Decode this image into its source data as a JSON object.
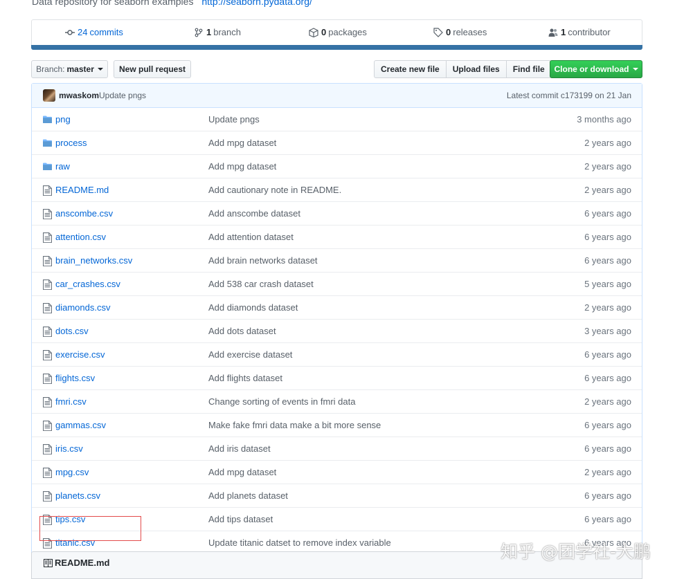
{
  "repo": {
    "description": "Data repository for seaborn examples",
    "homepage": "http://seaborn.pydata.org/"
  },
  "stats": {
    "commits": {
      "count": "24",
      "label": "commits"
    },
    "branches": {
      "count": "1",
      "label": "branch"
    },
    "packages": {
      "count": "0",
      "label": "packages"
    },
    "releases": {
      "count": "0",
      "label": "releases"
    },
    "contributors": {
      "count": "1",
      "label": "contributor"
    }
  },
  "language_bar_color": "#3572a5",
  "toolbar": {
    "branch_prefix": "Branch:",
    "branch_name": "master",
    "new_pull_request": "New pull request",
    "create_new_file": "Create new file",
    "upload_files": "Upload files",
    "find_file": "Find file",
    "clone_or_download": "Clone or download"
  },
  "latest_commit": {
    "author": "mwaskom",
    "message": "Update pngs",
    "summary": "Latest commit c173199 on 21 Jan"
  },
  "files": [
    {
      "name": "png",
      "type": "dir",
      "message": "Update pngs",
      "age": "3 months ago"
    },
    {
      "name": "process",
      "type": "dir",
      "message": "Add mpg dataset",
      "age": "2 years ago"
    },
    {
      "name": "raw",
      "type": "dir",
      "message": "Add mpg dataset",
      "age": "2 years ago"
    },
    {
      "name": "README.md",
      "type": "file",
      "message": "Add cautionary note in README.",
      "age": "2 years ago"
    },
    {
      "name": "anscombe.csv",
      "type": "file",
      "message": "Add anscombe dataset",
      "age": "6 years ago"
    },
    {
      "name": "attention.csv",
      "type": "file",
      "message": "Add attention dataset",
      "age": "6 years ago"
    },
    {
      "name": "brain_networks.csv",
      "type": "file",
      "message": "Add brain networks dataset",
      "age": "6 years ago"
    },
    {
      "name": "car_crashes.csv",
      "type": "file",
      "message": "Add 538 car crash dataset",
      "age": "5 years ago"
    },
    {
      "name": "diamonds.csv",
      "type": "file",
      "message": "Add diamonds dataset",
      "age": "2 years ago"
    },
    {
      "name": "dots.csv",
      "type": "file",
      "message": "Add dots dataset",
      "age": "3 years ago"
    },
    {
      "name": "exercise.csv",
      "type": "file",
      "message": "Add exercise dataset",
      "age": "6 years ago"
    },
    {
      "name": "flights.csv",
      "type": "file",
      "message": "Add flights dataset",
      "age": "6 years ago"
    },
    {
      "name": "fmri.csv",
      "type": "file",
      "message": "Change sorting of events in fmri data",
      "age": "2 years ago"
    },
    {
      "name": "gammas.csv",
      "type": "file",
      "message": "Make fake fmri data make a bit more sense",
      "age": "6 years ago"
    },
    {
      "name": "iris.csv",
      "type": "file",
      "message": "Add iris dataset",
      "age": "6 years ago"
    },
    {
      "name": "mpg.csv",
      "type": "file",
      "message": "Add mpg dataset",
      "age": "2 years ago"
    },
    {
      "name": "planets.csv",
      "type": "file",
      "message": "Add planets dataset",
      "age": "6 years ago"
    },
    {
      "name": "tips.csv",
      "type": "file",
      "message": "Add tips dataset",
      "age": "6 years ago"
    },
    {
      "name": "titanic.csv",
      "type": "file",
      "message": "Update titanic datset to remove index variable",
      "age": "6 years ago"
    }
  ],
  "readme": {
    "label": "README.md"
  },
  "watermark": "知乎 @团学社-大鹏"
}
